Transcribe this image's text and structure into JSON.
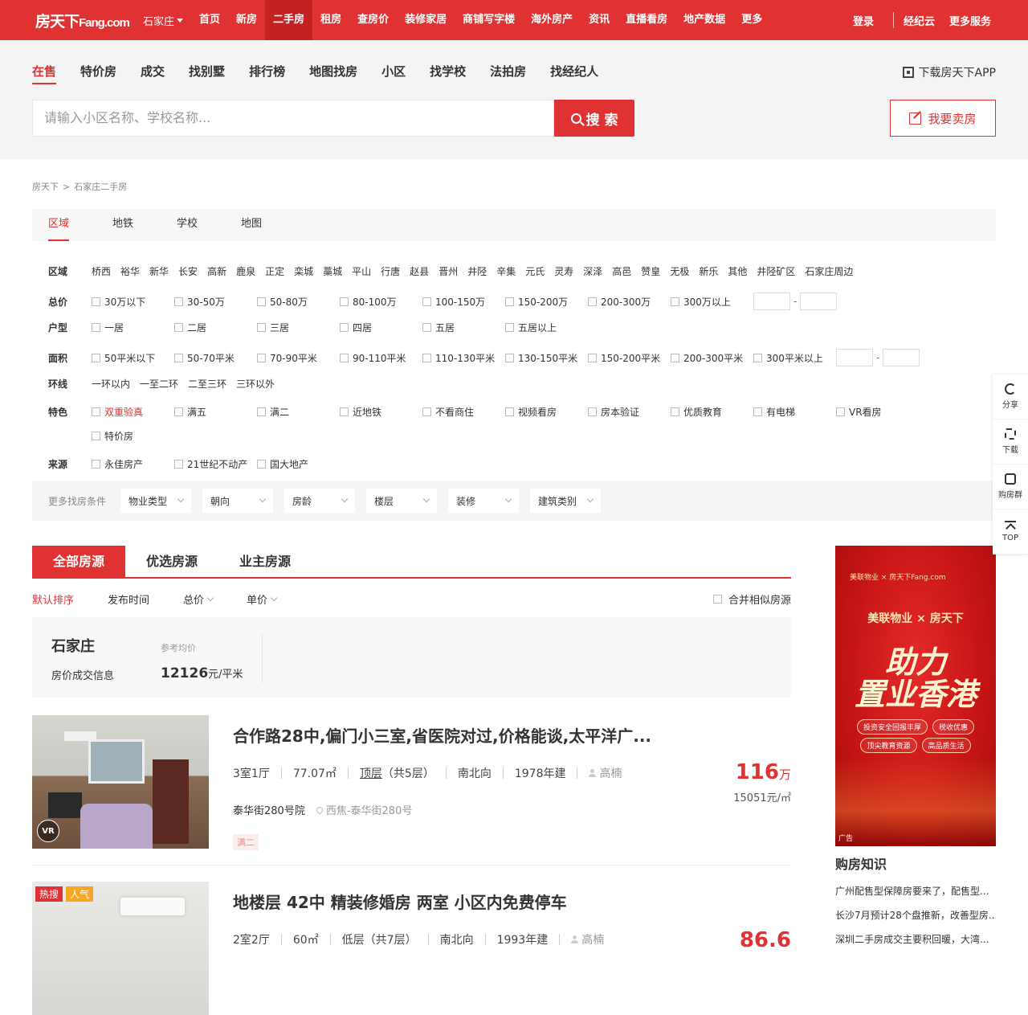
{
  "topbar": {
    "logo_main": "房天下",
    "logo_sub": "Fang.com",
    "city": "石家庄",
    "nav": [
      "首页",
      "新房",
      "二手房",
      "租房",
      "查房价",
      "装修家居",
      "商铺写字楼",
      "海外房产",
      "资讯",
      "直播看房",
      "地产数据",
      "更多"
    ],
    "active_nav_index": 2,
    "login": "登录",
    "agent": "经纪云",
    "more_service": "更多服务"
  },
  "subnav": {
    "items": [
      "在售",
      "特价房",
      "成交",
      "找别墅",
      "排行榜",
      "地图找房",
      "小区",
      "找学校",
      "法拍房",
      "找经纪人"
    ],
    "active_index": 0,
    "app_download": "下载房天下APP"
  },
  "search": {
    "placeholder": "请输入小区名称、学校名称...",
    "button": "搜 索",
    "sell_button": "我要卖房"
  },
  "breadcrumb": [
    "房天下",
    ">",
    "石家庄二手房"
  ],
  "filter_tabs": [
    "区域",
    "地铁",
    "学校",
    "地图"
  ],
  "filters": {
    "district": {
      "label": "区域",
      "items": [
        "桥西",
        "裕华",
        "新华",
        "长安",
        "高新",
        "鹿泉",
        "正定",
        "栾城",
        "藁城",
        "平山",
        "行唐",
        "赵县",
        "晋州",
        "井陉",
        "辛集",
        "元氏",
        "灵寿",
        "深泽",
        "高邑",
        "赞皇",
        "无极",
        "新乐",
        "其他",
        "井陉矿区",
        "石家庄周边"
      ]
    },
    "price": {
      "label": "总价",
      "items": [
        "30万以下",
        "30-50万",
        "50-80万",
        "80-100万",
        "100-150万",
        "150-200万",
        "200-300万",
        "300万以上"
      ]
    },
    "layout": {
      "label": "户型",
      "items": [
        "一居",
        "二居",
        "三居",
        "四居",
        "五居",
        "五居以上"
      ]
    },
    "area": {
      "label": "面积",
      "items": [
        "50平米以下",
        "50-70平米",
        "70-90平米",
        "90-110平米",
        "110-130平米",
        "130-150平米",
        "150-200平米",
        "200-300平米",
        "300平米以上"
      ]
    },
    "ring": {
      "label": "环线",
      "items": [
        "一环以内",
        "一至二环",
        "二至三环",
        "三环以外"
      ]
    },
    "feature": {
      "label": "特色",
      "items": [
        "双重验真",
        "满五",
        "满二",
        "近地铁",
        "不看商住",
        "视频看房",
        "房本验证",
        "优质教育",
        "有电梯",
        "VR看房",
        "特价房"
      ]
    },
    "source": {
      "label": "来源",
      "items": [
        "永佳房产",
        "21世纪不动产",
        "国大地产"
      ]
    }
  },
  "more_filters": {
    "label": "更多找房条件",
    "dropdowns": [
      "物业类型",
      "朝向",
      "房龄",
      "楼层",
      "装修",
      "建筑类别"
    ]
  },
  "list_tabs": [
    "全部房源",
    "优选房源",
    "业主房源"
  ],
  "sort": {
    "items": [
      "默认排序",
      "发布时间",
      "总价",
      "单价"
    ],
    "merge": "合并相似房源"
  },
  "price_info": {
    "city": "石家庄",
    "deal_info": "房价成交信息",
    "ref_label": "参考均价",
    "avg_value": "12126",
    "avg_unit": "元/平米"
  },
  "listings": [
    {
      "title": "合作路28中,偏门小三室,省医院对过,价格能谈,太平洋广...",
      "rooms": "3室1厅",
      "size": "77.07㎡",
      "floor": "顶层",
      "floor_total": "（共5层）",
      "facing": "南北向",
      "built": "1978年建",
      "agent": "高楠",
      "community": "泰华街280号院",
      "location": "西焦-泰华街280号",
      "tag": "满二",
      "price": "116",
      "price_unit": "万",
      "unit_price": "15051元/㎡",
      "badge": "VR"
    },
    {
      "title": "地楼层 42中 精装修婚房 两室 小区内免费停车",
      "rooms": "2室2厅",
      "size": "60㎡",
      "floor": "低层",
      "floor_total": "（共7层）",
      "facing": "南北向",
      "built": "1993年建",
      "agent": "高楠",
      "price": "86.6",
      "hot_tags": [
        "热搜",
        "人气"
      ]
    }
  ],
  "ad": {
    "logo": "美联物业 × 房天下Fang.com",
    "subtitle": "美联物业 × 房天下",
    "headline1": "助力",
    "headline2": "置业香港",
    "pills": [
      "投资安全回报丰厚",
      "税收优惠",
      "顶尖教育资源",
      "高品质生活"
    ],
    "tag": "广告"
  },
  "knowledge": {
    "title": "购房知识",
    "items": [
      "广州配售型保障房要来了，配售型...",
      "长沙7月预计28个盘推新，改善型房...",
      "深圳二手房成交主要积回暖，大湾..."
    ]
  },
  "sidebar": [
    "分享",
    "下载",
    "购房群",
    "TOP"
  ],
  "colors": {
    "brand": "#e03232"
  }
}
